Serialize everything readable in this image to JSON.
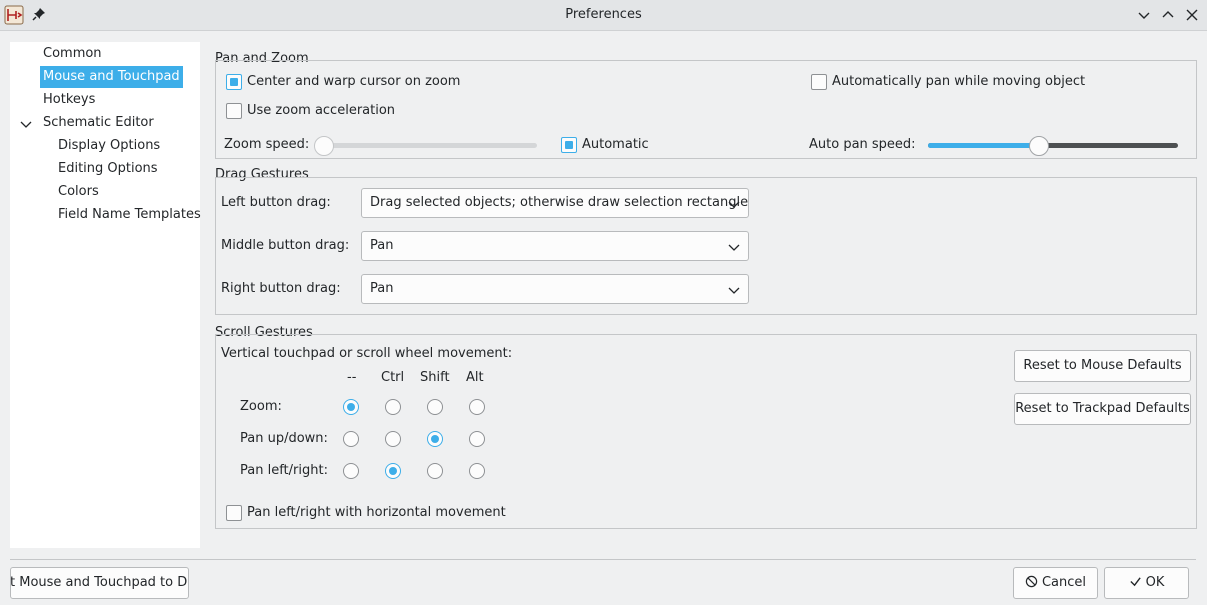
{
  "window": {
    "title": "Preferences",
    "app_icon": "kicad-eeschema-icon",
    "pin_icon": "pin-icon",
    "controls": [
      "chevron-down-icon",
      "chevron-up-icon",
      "close-icon"
    ]
  },
  "sidebar": {
    "items": [
      {
        "label": "Common"
      },
      {
        "label": "Mouse and Touchpad",
        "selected": true
      },
      {
        "label": "Hotkeys"
      },
      {
        "label": "Schematic Editor",
        "expanded": true
      },
      {
        "label": "Display Options"
      },
      {
        "label": "Editing Options"
      },
      {
        "label": "Colors"
      },
      {
        "label": "Field Name Templates"
      }
    ]
  },
  "pan_zoom": {
    "title": "Pan and Zoom",
    "center_warp": {
      "label": "Center and warp cursor on zoom",
      "checked": true
    },
    "auto_pan": {
      "label": "Automatically pan while moving object",
      "checked": false
    },
    "zoom_accel": {
      "label": "Use zoom acceleration",
      "checked": false
    },
    "zoom_speed": {
      "label": "Zoom speed:",
      "value": 0.0,
      "enabled": false
    },
    "automatic": {
      "label": "Automatic",
      "checked": true
    },
    "auto_pan_speed": {
      "label": "Auto pan speed:",
      "value": 0.44
    }
  },
  "drag": {
    "title": "Drag Gestures",
    "left": {
      "label": "Left button drag:",
      "value": "Drag selected objects; otherwise draw selection rectangle"
    },
    "middle": {
      "label": "Middle button drag:",
      "value": "Pan"
    },
    "right": {
      "label": "Right button drag:",
      "value": "Pan"
    }
  },
  "scroll": {
    "title": "Scroll Gestures",
    "subtitle": "Vertical touchpad or scroll wheel movement:",
    "columns": [
      "--",
      "Ctrl",
      "Shift",
      "Alt"
    ],
    "rows": [
      {
        "label": "Zoom:",
        "selected": 0
      },
      {
        "label": "Pan up/down:",
        "selected": 2
      },
      {
        "label": "Pan left/right:",
        "selected": 1
      }
    ],
    "horizontal": {
      "label": "Pan left/right with horizontal movement",
      "checked": false
    },
    "reset_mouse": "Reset to Mouse Defaults",
    "reset_trackpad": "Reset to Trackpad Defaults"
  },
  "footer": {
    "reset_page": "t Mouse and Touchpad to Def",
    "cancel": "Cancel",
    "cancel_icon": "cancel-icon",
    "ok": "OK",
    "ok_icon": "checkmark-icon"
  },
  "colors": {
    "accent": "#3daee9",
    "window_bg": "#eff0f1",
    "panel_bg": "#ffffff"
  }
}
